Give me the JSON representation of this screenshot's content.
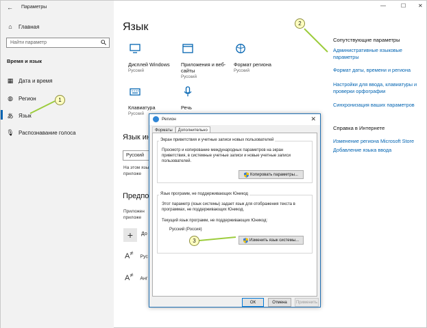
{
  "window": {
    "title": "Параметры",
    "minimize": "—",
    "maximize": "☐",
    "close": "✕"
  },
  "sidebar": {
    "home": "Главная",
    "search_placeholder": "Найти параметр",
    "section": "Время и язык",
    "items": [
      {
        "label": "Дата и время",
        "icon": "calendar-clock-icon"
      },
      {
        "label": "Регион",
        "icon": "globe-region-icon"
      },
      {
        "label": "Язык",
        "icon": "language-icon",
        "active": true
      },
      {
        "label": "Распознавание голоса",
        "icon": "microphone-icon"
      }
    ]
  },
  "main": {
    "title": "Язык",
    "tiles": [
      {
        "name": "Дисплей Windows",
        "sub": "Русский",
        "icon": "display-icon"
      },
      {
        "name": "Приложения и веб-сайты",
        "sub": "Русский",
        "icon": "apps-window-icon"
      },
      {
        "name": "Формат региона",
        "sub": "Русский",
        "icon": "region-format-icon"
      },
      {
        "name": "Клавиатура",
        "sub": "Русский",
        "icon": "keyboard-icon"
      },
      {
        "name": "Речь",
        "sub": "Русский",
        "icon": "microphone-icon"
      }
    ],
    "display_lang_heading": "Язык ин",
    "display_lang_value": "Русский",
    "display_lang_note_1": "На этом язы",
    "display_lang_note_2": "приложе",
    "pref_heading": "Предпоч",
    "pref_note_1": "Приложен",
    "pref_note_2": "приложе",
    "add_label": "До",
    "lang_rows": [
      "Рус",
      "Анг"
    ]
  },
  "related": {
    "heading": "Сопутствующие параметры",
    "links": [
      "Административные языковые параметры",
      "Формат даты, времени и региона",
      "Настройки для ввода, клавиатуры и проверки орфографии",
      "Синхронизация ваших параметров"
    ],
    "help_heading": "Справка в Интернете",
    "help_links": [
      "Изменение региона Microsoft Store",
      "Добавление языка ввода"
    ]
  },
  "dialog": {
    "title": "Регион",
    "tabs": [
      "Форматы",
      "Дополнительно"
    ],
    "group1": {
      "title": "Экран приветствия и учетные записи новых пользователей",
      "text": "Просмотр и копирование международных параметров на экран приветствия, в системные учетные записи и новые учетные записи пользователей.",
      "button": "Копировать параметры..."
    },
    "group2": {
      "title": "Язык программ, не поддерживающих Юникод",
      "text": "Этот параметр (язык системы) задает язык для отображения текста в программах, не поддерживающих Юникод.",
      "current_label": "Текущий язык программ, не поддерживающих Юникод:",
      "current_value": "Русский (Россия)",
      "button": "Изменить язык системы..."
    },
    "ok": "ОК",
    "cancel": "Отмена",
    "apply": "Применить"
  },
  "callouts": [
    "1",
    "2",
    "3"
  ],
  "colors": {
    "accent": "#0063b1",
    "callout": "#ffffc0",
    "pointer": "#9ccc3c"
  }
}
